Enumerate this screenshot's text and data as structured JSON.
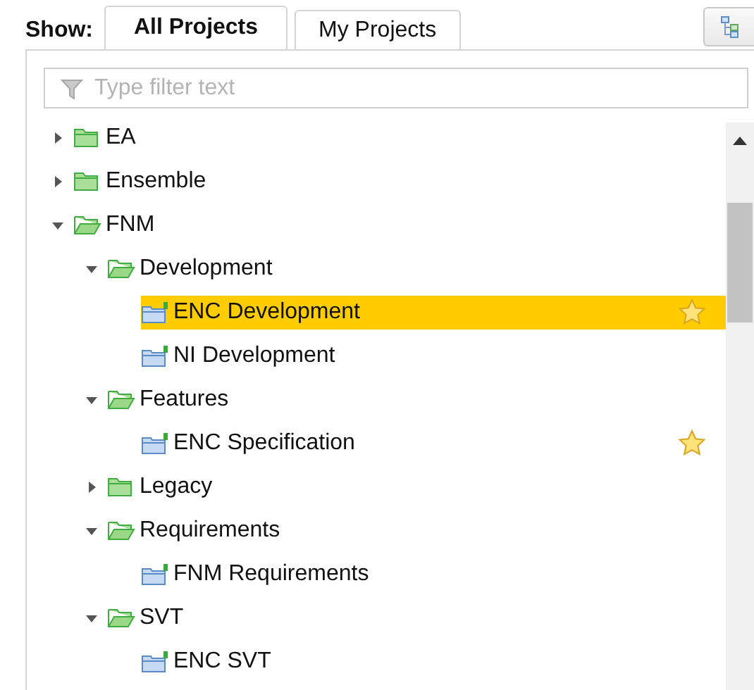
{
  "show_label": "Show:",
  "tabs": [
    {
      "label": "All Projects",
      "selected": true
    },
    {
      "label": "My Projects",
      "selected": false
    }
  ],
  "filter": {
    "placeholder": "Type filter text"
  },
  "tree": [
    {
      "label": "EA",
      "kind": "folder",
      "expanded": false,
      "selected": false,
      "starred": false
    },
    {
      "label": "Ensemble",
      "kind": "folder",
      "expanded": false,
      "selected": false,
      "starred": false
    },
    {
      "label": "FNM",
      "kind": "folder",
      "expanded": true,
      "selected": false,
      "starred": false,
      "children": [
        {
          "label": "Development",
          "kind": "folder",
          "expanded": true,
          "selected": false,
          "starred": false,
          "children": [
            {
              "label": "ENC Development",
              "kind": "project",
              "selected": true,
              "starred": true
            },
            {
              "label": "NI Development",
              "kind": "project",
              "selected": false,
              "starred": false
            }
          ]
        },
        {
          "label": "Features",
          "kind": "folder",
          "expanded": true,
          "selected": false,
          "starred": false,
          "children": [
            {
              "label": "ENC Specification",
              "kind": "project",
              "selected": false,
              "starred": true
            }
          ]
        },
        {
          "label": "Legacy",
          "kind": "folder",
          "expanded": false,
          "selected": false,
          "starred": false
        },
        {
          "label": "Requirements",
          "kind": "folder",
          "expanded": true,
          "selected": false,
          "starred": false,
          "children": [
            {
              "label": "FNM Requirements",
              "kind": "project",
              "selected": false,
              "starred": false
            }
          ]
        },
        {
          "label": "SVT",
          "kind": "folder",
          "expanded": true,
          "selected": false,
          "starred": false,
          "children": [
            {
              "label": "ENC SVT",
              "kind": "project",
              "selected": false,
              "starred": false
            }
          ]
        }
      ]
    }
  ]
}
